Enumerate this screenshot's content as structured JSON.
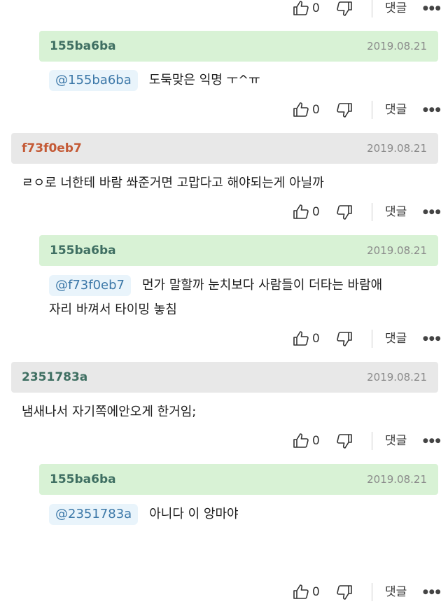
{
  "actions": {
    "like_count": "0",
    "reply_label": "댓글",
    "more_label": "●●●"
  },
  "comments": [
    {
      "author": "155ba6ba",
      "date": "2019.08.21",
      "mention": "@155ba6ba",
      "line1": "도둑맞은 익명 ㅜ^ㅠ"
    },
    {
      "author": "f73f0eb7",
      "date": "2019.08.21",
      "line1": "ㄹㅇ로 너한테 바람 쏴준거면 고맙다고 해야되는게 아닐까"
    },
    {
      "author": "155ba6ba",
      "date": "2019.08.21",
      "mention": "@f73f0eb7",
      "line1": "먼가 말할까 눈치보다 사람들이 더타는 바람애",
      "line2": "자리 바껴서 타이밍 놓침"
    },
    {
      "author": "2351783a",
      "date": "2019.08.21",
      "line1": "냄새나서 자기쪽에안오게 한거임;"
    },
    {
      "author": "155ba6ba",
      "date": "2019.08.21",
      "mention": "@2351783a",
      "line1": "아니다 이 앙마야"
    }
  ]
}
